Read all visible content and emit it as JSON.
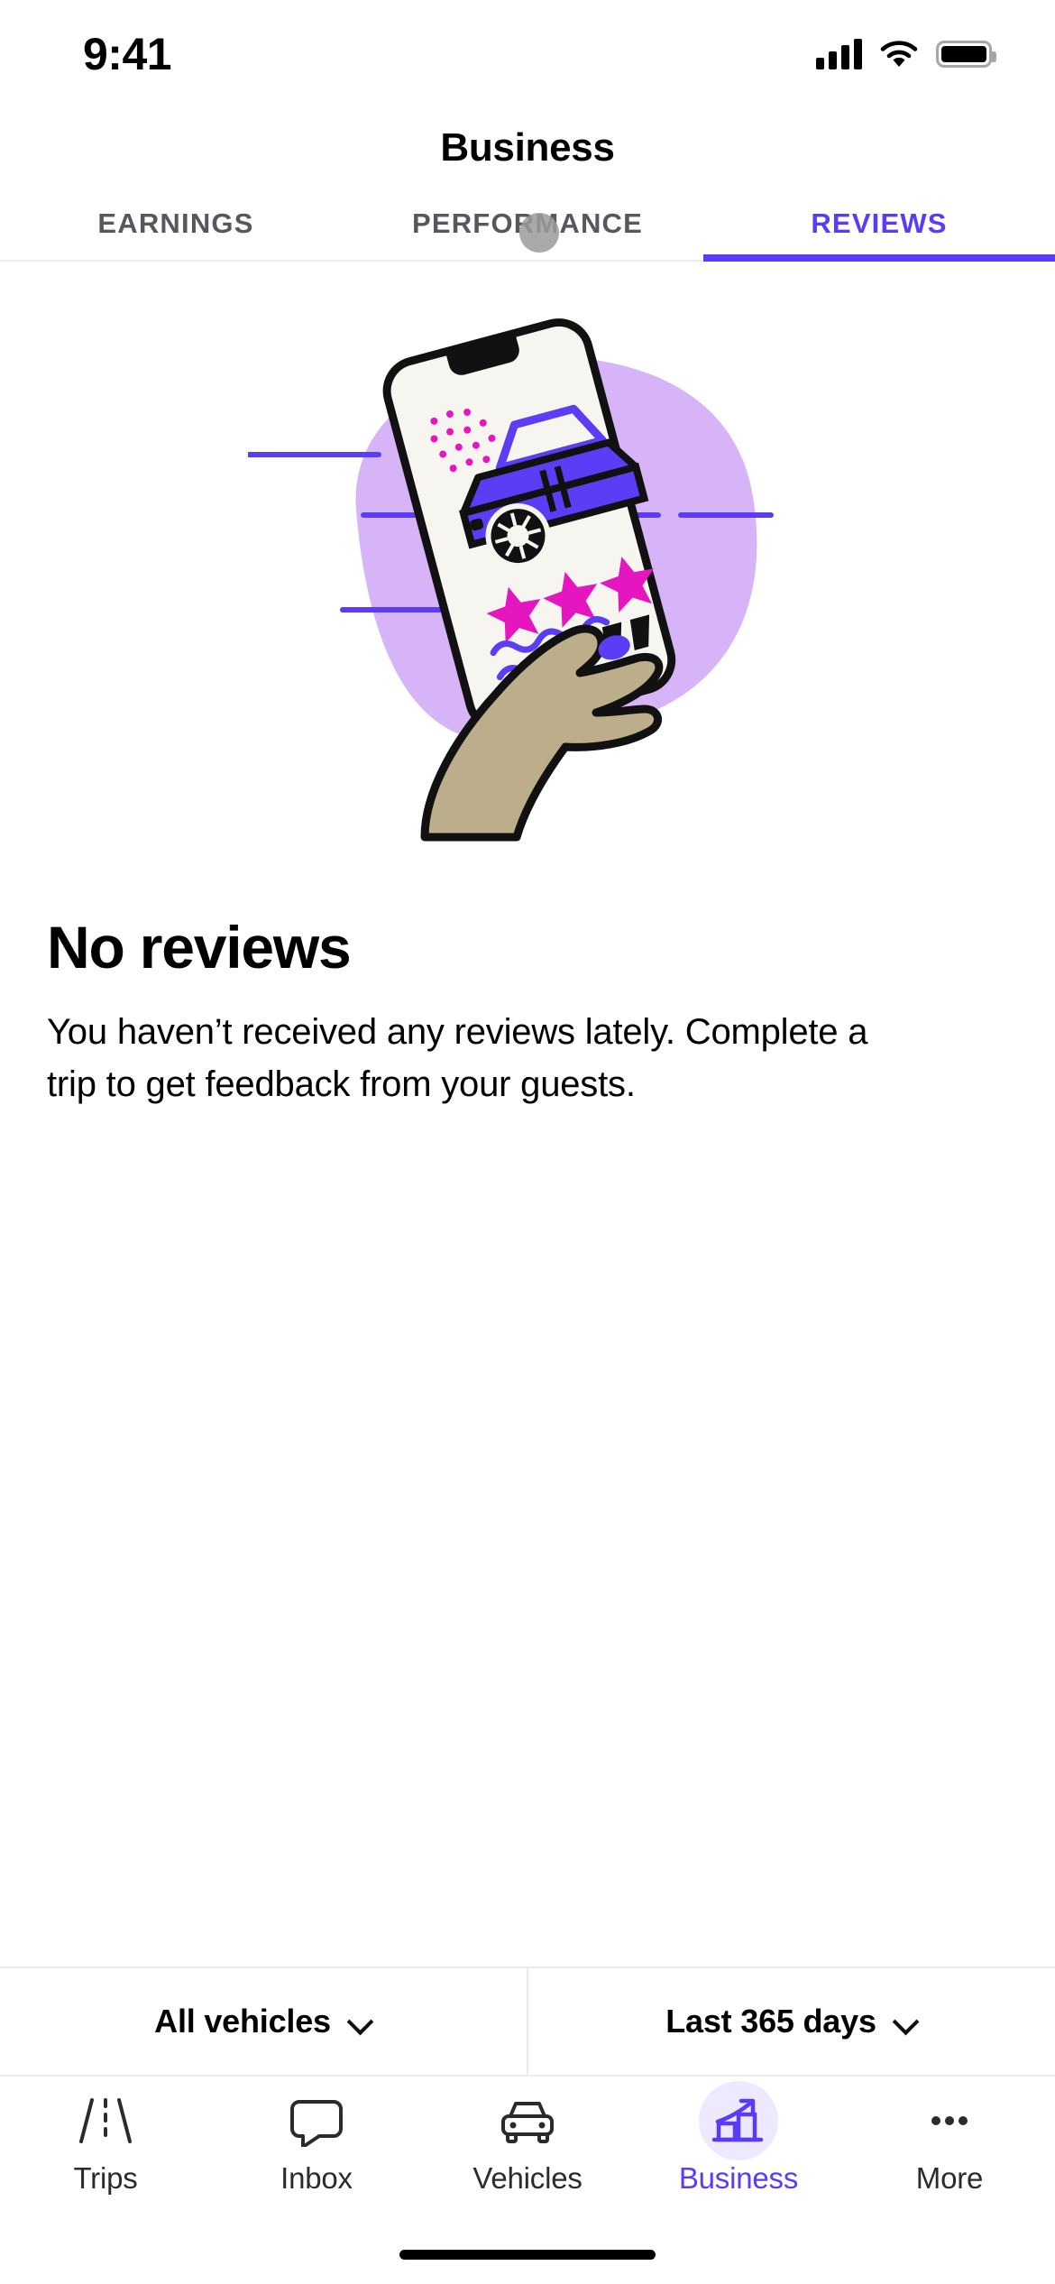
{
  "status_bar": {
    "time": "9:41",
    "signal_icon": "cellular-signal-icon",
    "wifi_icon": "wifi-icon",
    "battery_icon": "battery-icon"
  },
  "header": {
    "title": "Business"
  },
  "tabs": {
    "active_index": 2,
    "accent_color": "#593cfb",
    "inactive_color": "#57575e",
    "items": [
      {
        "label": "EARNINGS"
      },
      {
        "label": "PERFORMANCE"
      },
      {
        "label": "REVIEWS"
      }
    ]
  },
  "empty_state": {
    "illustration_name": "hand-holding-phone-review-illustration",
    "title": "No reviews",
    "body": "You haven’t received any reviews lately. Complete a trip to get feedback from your guests.",
    "colors": {
      "blob": "#d6b4f7",
      "car": "#5b3df5",
      "star": "#e516c0",
      "hand": "#bcae8b",
      "line": "#5b3df5",
      "accent_pink": "#e516c0"
    }
  },
  "filters": {
    "vehicle": {
      "label": "All vehicles",
      "chevron_icon": "chevron-down-icon"
    },
    "date_range": {
      "label": "Last 365 days",
      "chevron_icon": "chevron-down-icon"
    }
  },
  "bottom_nav": {
    "active_index": 3,
    "active_color": "#593cfb",
    "items": [
      {
        "label": "Trips",
        "icon": "road-icon"
      },
      {
        "label": "Inbox",
        "icon": "speech-bubble-icon"
      },
      {
        "label": "Vehicles",
        "icon": "car-icon"
      },
      {
        "label": "Business",
        "icon": "bar-chart-growth-icon"
      },
      {
        "label": "More",
        "icon": "ellipsis-icon"
      }
    ]
  },
  "home_indicator": {
    "name": "home-indicator"
  }
}
